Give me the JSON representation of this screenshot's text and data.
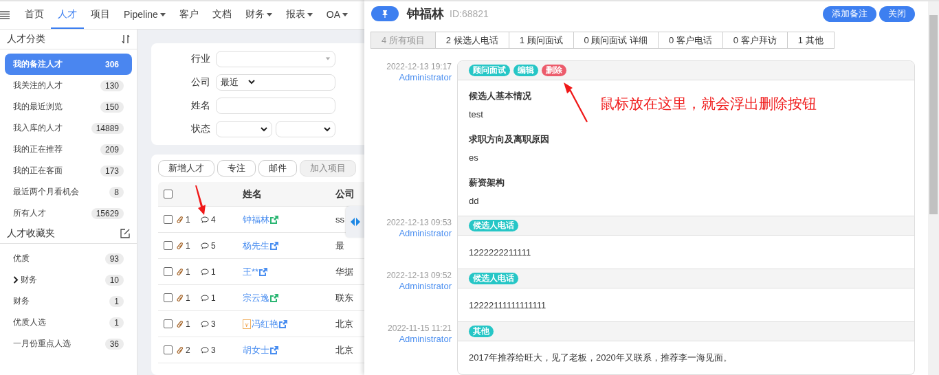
{
  "nav": {
    "items": [
      {
        "label": "首页",
        "dropdown": false,
        "selected": false
      },
      {
        "label": "人才",
        "dropdown": false,
        "selected": true
      },
      {
        "label": "项目",
        "dropdown": false,
        "selected": false
      },
      {
        "label": "Pipeline",
        "dropdown": true,
        "selected": false
      },
      {
        "label": "客户",
        "dropdown": false,
        "selected": false
      },
      {
        "label": "文档",
        "dropdown": false,
        "selected": false
      },
      {
        "label": "财务",
        "dropdown": true,
        "selected": false
      },
      {
        "label": "报表",
        "dropdown": true,
        "selected": false
      },
      {
        "label": "OA",
        "dropdown": true,
        "selected": false
      }
    ]
  },
  "sidebar": {
    "sections": [
      {
        "title": "人才分类",
        "kind": "sort",
        "items": [
          {
            "label": "我的备注人才",
            "count": "306",
            "selected": true,
            "kind": "item"
          },
          {
            "label": "我关注的人才",
            "count": "130",
            "selected": false,
            "kind": "item"
          },
          {
            "label": "我的最近浏览",
            "count": "150",
            "selected": false,
            "kind": "item"
          },
          {
            "label": "我入库的人才",
            "count": "14889",
            "selected": false,
            "kind": "item"
          },
          {
            "label": "我的正在推荐",
            "count": "209",
            "selected": false,
            "kind": "item"
          },
          {
            "label": "我的正在客面",
            "count": "173",
            "selected": false,
            "kind": "item"
          },
          {
            "label": "最近两个月看机会",
            "count": "8",
            "selected": false,
            "kind": "item"
          },
          {
            "label": "所有人才",
            "count": "15629",
            "selected": false,
            "kind": "item"
          }
        ]
      },
      {
        "title": "人才收藏夹",
        "kind": "edit",
        "items": [
          {
            "label": "优质",
            "count": "93",
            "selected": false,
            "kind": "item"
          },
          {
            "label": "财务",
            "count": "10",
            "selected": false,
            "kind": "folder"
          },
          {
            "label": "财务",
            "count": "1",
            "selected": false,
            "kind": "item"
          },
          {
            "label": "优质人选",
            "count": "1",
            "selected": false,
            "kind": "item"
          },
          {
            "label": "一月份重点人选",
            "count": "36",
            "selected": false,
            "kind": "item"
          }
        ]
      }
    ]
  },
  "filters": {
    "fields": [
      {
        "label": "行业",
        "kind": "select"
      },
      {
        "label": "公司",
        "kind": "combo",
        "value": "最近"
      },
      {
        "label": "姓名",
        "kind": "text"
      },
      {
        "label": "状态",
        "kind": "double-select"
      }
    ]
  },
  "toolbar": {
    "buttons": [
      {
        "label": "新增人才",
        "disabled": false
      },
      {
        "label": "专注",
        "disabled": false
      },
      {
        "label": "邮件",
        "disabled": false
      },
      {
        "label": "加入项目",
        "disabled": true
      }
    ]
  },
  "table": {
    "columns": [
      "姓名",
      "公司"
    ],
    "all_checked": false,
    "rows": [
      {
        "checked": false,
        "attachments": "1",
        "comments": "4",
        "name": "钟福林",
        "color": "#2bb673",
        "company": "ss"
      },
      {
        "checked": false,
        "attachments": "1",
        "comments": "5",
        "name": "杨先生",
        "color": "#4a8ef0",
        "company": "最"
      },
      {
        "checked": false,
        "attachments": "1",
        "comments": "1",
        "name": "王**",
        "color": "#4a8ef0",
        "company": "华据"
      },
      {
        "checked": false,
        "attachments": "1",
        "comments": "1",
        "name": "宗云逸",
        "color": "#2bb673",
        "company": "联东"
      },
      {
        "checked": false,
        "attachments": "1",
        "comments": "3",
        "badge": "v",
        "name": "冯红艳",
        "color": "#4a8ef0",
        "company": "北京"
      },
      {
        "checked": false,
        "attachments": "2",
        "comments": "3",
        "name": "胡女士",
        "color": "#4a8ef0",
        "company": "北京"
      }
    ]
  },
  "annotation": {
    "text": "鼠标放在这里，就会浮出删除按钮"
  },
  "detail": {
    "title": "钟福林",
    "id": "ID:68821",
    "buttons": [
      "添加备注",
      "关闭"
    ],
    "tabs": [
      {
        "label": "4 所有项目",
        "selected": true
      },
      {
        "label": "2 候选人电话",
        "selected": false
      },
      {
        "label": "1 顾问面试",
        "selected": false
      },
      {
        "label": "0 顾问面试 详细",
        "selected": false
      },
      {
        "label": "0 客户电话",
        "selected": false
      },
      {
        "label": "0 客户拜访",
        "selected": false
      },
      {
        "label": "1 其他",
        "selected": false
      }
    ],
    "entries": [
      {
        "time": "2022-12-13 19:17",
        "author": "Administrator",
        "kind": "sections",
        "tags": [
          {
            "label": "顾问面试",
            "color": "#26c6c6"
          },
          {
            "label": "编辑",
            "color": "#26c6c6"
          },
          {
            "label": "删除",
            "color": "#ec5c6c"
          }
        ],
        "sections": [
          {
            "heading": "候选人基本情况",
            "text": "test"
          },
          {
            "heading": "求职方向及离职原因",
            "text": "es"
          },
          {
            "heading": "薪资架构",
            "text": "dd"
          }
        ]
      },
      {
        "time": "2022-12-13 09:53",
        "author": "Administrator",
        "kind": "note",
        "tags": [
          {
            "label": "候选人电话",
            "color": "#26c6c6"
          }
        ],
        "text": "1222222211111"
      },
      {
        "time": "2022-12-13 09:52",
        "author": "Administrator",
        "kind": "note",
        "tags": [
          {
            "label": "候选人电话",
            "color": "#26c6c6"
          }
        ],
        "text": "12222111111111111"
      },
      {
        "time": "2022-11-15 11:21",
        "author": "Administrator",
        "kind": "note",
        "tags": [
          {
            "label": "其他",
            "color": "#26c6c6"
          }
        ],
        "text": "2017年推荐给旺大，见了老板，2020年又联系，推荐李一海见面。"
      }
    ]
  }
}
